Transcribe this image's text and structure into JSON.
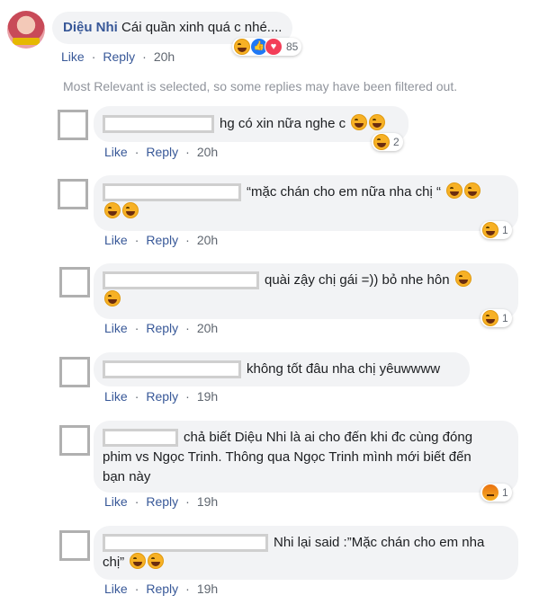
{
  "main_comment": {
    "author": "Diệu Nhi",
    "text": "Cái quần xinh quá c nhé....",
    "reaction_count": "85",
    "actions": {
      "like": "Like",
      "reply": "Reply",
      "time": "20h"
    }
  },
  "filter_note": "Most Relevant is selected, so some replies may have been filtered out.",
  "replies": [
    {
      "line1": "hg có xin nữa nghe c",
      "reaction_count": "2",
      "time": "20h"
    },
    {
      "line1": "“mặc chán cho em nữa nha chị “",
      "reaction_count": "1",
      "time": "20h"
    },
    {
      "line1": "quài zậy chị gái =)) bỏ nhe hôn",
      "reaction_count": "1",
      "time": "20h"
    },
    {
      "line1": "không tốt đâu nha chị yêuwwww",
      "time": "19h"
    },
    {
      "line1": "chả biết Diệu Nhi là ai cho đến khi đc cùng đóng",
      "line2": "phim vs Ngọc Trinh. Thông qua Ngọc Trinh mình mới biết đến",
      "line3": "bạn này",
      "reaction_count": "1",
      "time": "19h"
    },
    {
      "line1": "Nhi lại said :”Mặc chán cho em nha",
      "line2": "chị”",
      "time": "19h"
    }
  ],
  "labels": {
    "like": "Like",
    "reply": "Reply"
  },
  "colors": {
    "link": "#385898",
    "bubble": "#f2f3f5",
    "meta": "#90949c"
  },
  "icons": [
    "haha-emoji",
    "like-reaction",
    "love-reaction",
    "angry-reaction"
  ]
}
